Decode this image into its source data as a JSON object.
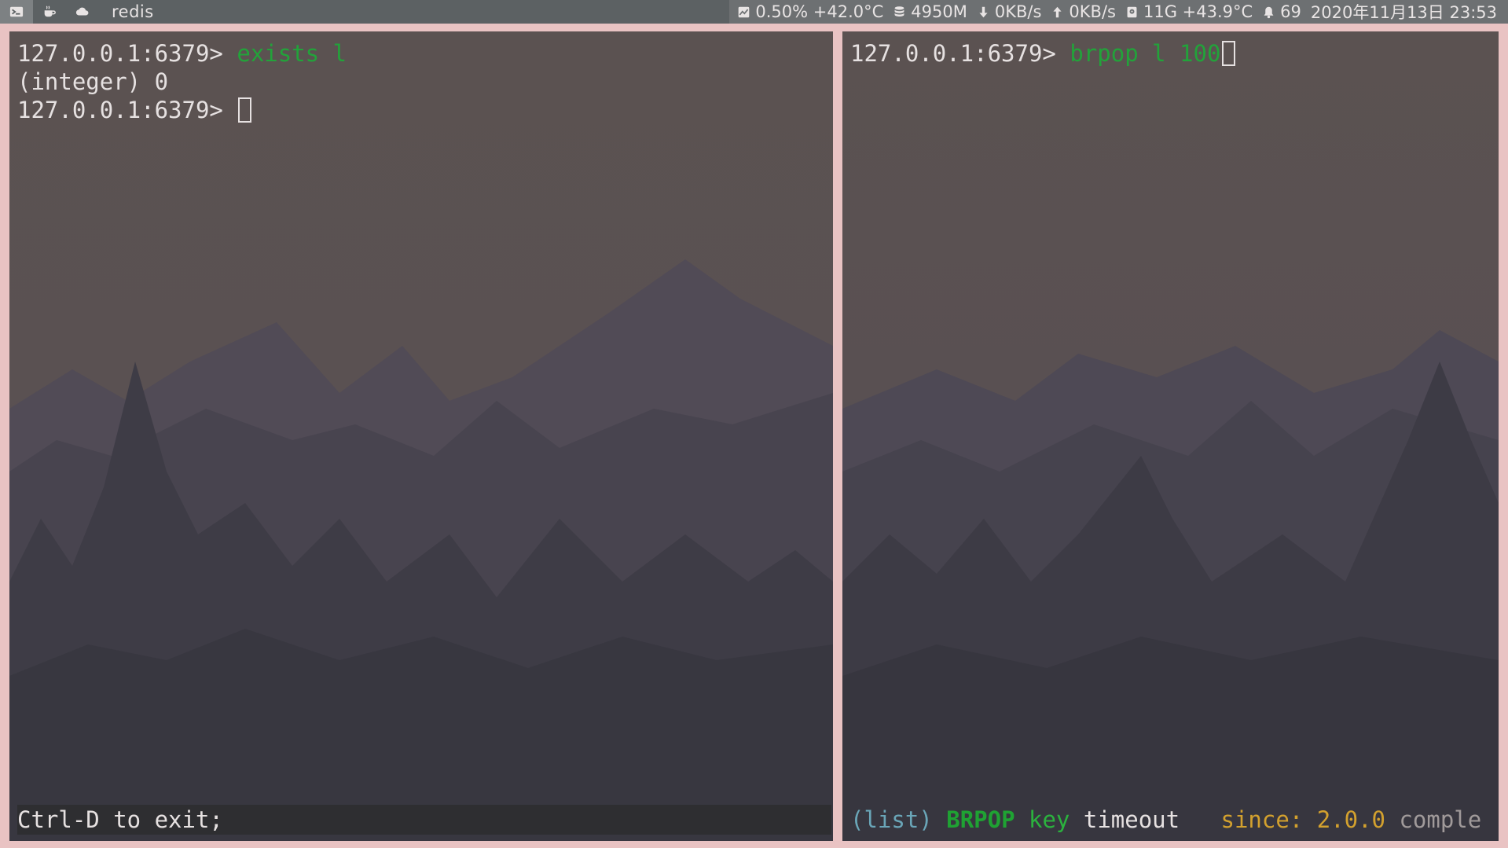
{
  "topbar": {
    "workspaces": [
      {
        "icon": "terminal-icon"
      },
      {
        "icon": "coffee-icon"
      },
      {
        "icon": "cloud-icon"
      }
    ],
    "window_title": "redis",
    "tray": {
      "cpu": "0.50% +42.0°C",
      "memory": "4950M",
      "net_down": "0KB/s",
      "net_up": "0KB/s",
      "disk": "11G +43.9°C",
      "notifications": "69",
      "datetime": "2020年11月13日 23:53"
    },
    "tray_icons": [
      "cpu-chart-icon",
      "database-icon",
      "arrow-down-icon",
      "arrow-up-icon",
      "disk-icon",
      "bell-icon"
    ]
  },
  "left_pane": {
    "lines": [
      {
        "prompt": "127.0.0.1:6379> ",
        "command": "exists l"
      },
      {
        "output": "(integer) 0"
      },
      {
        "prompt": "127.0.0.1:6379> ",
        "command": ""
      }
    ],
    "hint": "Ctrl-D to exit;"
  },
  "right_pane": {
    "lines": [
      {
        "prompt": "127.0.0.1:6379> ",
        "command": "brpop l 100"
      }
    ],
    "hint": {
      "group": "(list)",
      "command": "BRPOP",
      "key_arg": "key",
      "timeout_arg": "timeout",
      "since": "since: 2.0.0",
      "group_text": "comple"
    }
  },
  "colors": {
    "prompt_text": "#e6e1e1",
    "command_green": "#22a33a",
    "topbar_bg": "#5c6163",
    "border_pink": "#e9c3c3",
    "since_gold": "#d3a12e"
  }
}
